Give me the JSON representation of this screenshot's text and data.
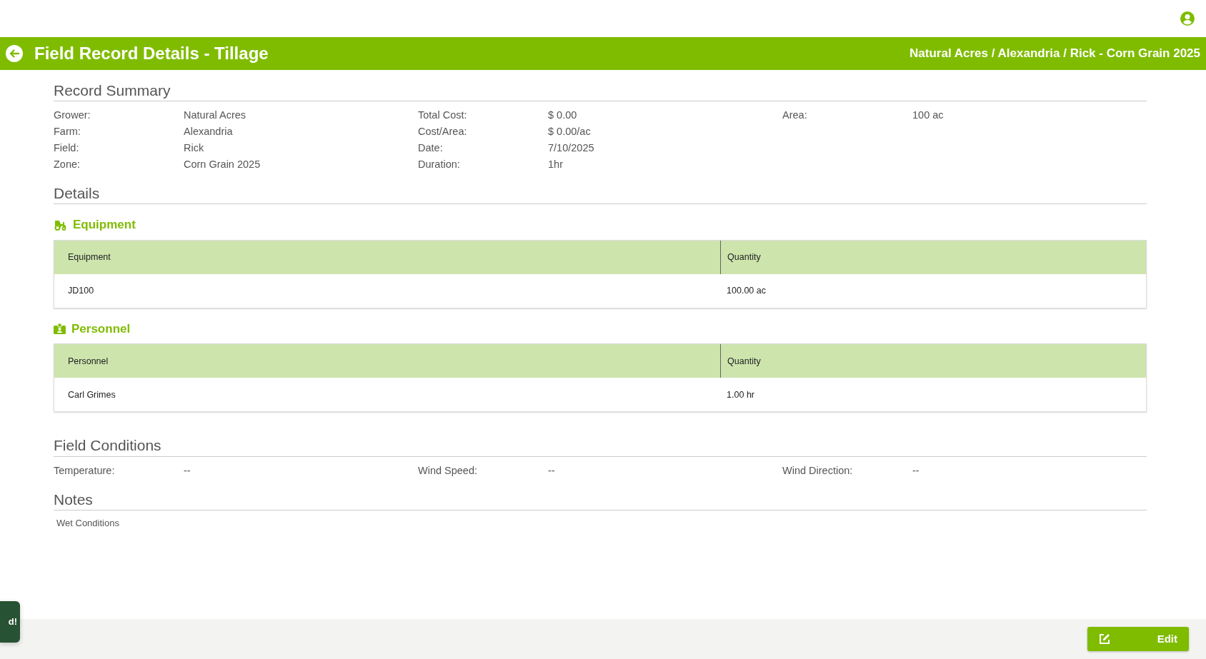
{
  "header": {
    "title": "Field Record Details - Tillage",
    "breadcrumb": "Natural Acres / Alexandria / Rick - Corn Grain 2025"
  },
  "record_summary": {
    "title": "Record Summary",
    "columns": [
      [
        {
          "label": "Grower:",
          "value": "Natural Acres"
        },
        {
          "label": "Farm:",
          "value": "Alexandria"
        },
        {
          "label": "Field:",
          "value": "Rick"
        },
        {
          "label": "Zone:",
          "value": "Corn Grain 2025"
        }
      ],
      [
        {
          "label": "Total Cost:",
          "value": "$ 0.00"
        },
        {
          "label": "Cost/Area:",
          "value": "$ 0.00/ac"
        },
        {
          "label": "Date:",
          "value": "7/10/2025"
        },
        {
          "label": "Duration:",
          "value": "1hr"
        }
      ],
      [
        {
          "label": "Area:",
          "value": "100 ac"
        }
      ]
    ]
  },
  "details": {
    "title": "Details",
    "sections": [
      {
        "kind": "equipment",
        "title": "Equipment",
        "columns": [
          "Equipment",
          "Quantity"
        ],
        "rows": [
          [
            "JD100",
            "100.00 ac"
          ]
        ]
      },
      {
        "kind": "personnel",
        "title": "Personnel",
        "columns": [
          "Personnel",
          "Quantity"
        ],
        "rows": [
          [
            "Carl Grimes",
            "1.00 hr"
          ]
        ]
      }
    ]
  },
  "field_conditions": {
    "title": "Field Conditions",
    "items": [
      {
        "label": "Temperature:",
        "value": "--"
      },
      {
        "label": "Wind Speed:",
        "value": "--"
      },
      {
        "label": "Wind Direction:",
        "value": "--"
      }
    ]
  },
  "notes": {
    "title": "Notes",
    "text": "Wet Conditions"
  },
  "toast": {
    "text": "d!"
  },
  "footer": {
    "edit_button": "Edit"
  }
}
